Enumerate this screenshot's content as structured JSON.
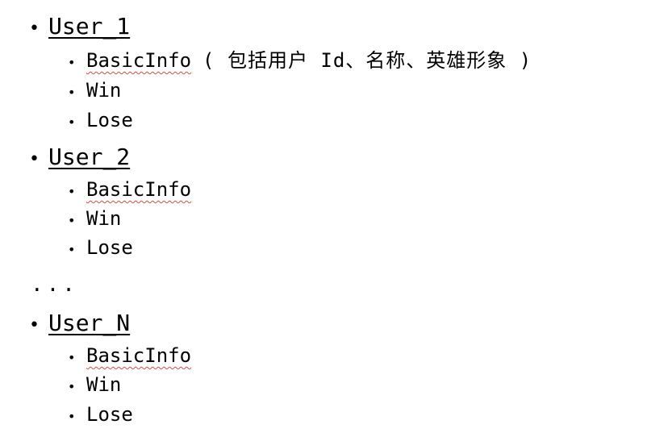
{
  "list": {
    "user1": {
      "label": "User_1",
      "items": {
        "basic": "BasicInfo",
        "note": "( 包括用户 Id、名称、英雄形象 )",
        "win": "Win",
        "lose": "Lose"
      }
    },
    "user2": {
      "label": "User_2",
      "items": {
        "basic": "BasicInfo",
        "win": "Win",
        "lose": "Lose"
      }
    },
    "ellipsis": "...",
    "userN": {
      "label": "User_N",
      "items": {
        "basic": "BasicInfo",
        "win": "Win",
        "lose": "Lose"
      }
    },
    "bullet": "•"
  }
}
